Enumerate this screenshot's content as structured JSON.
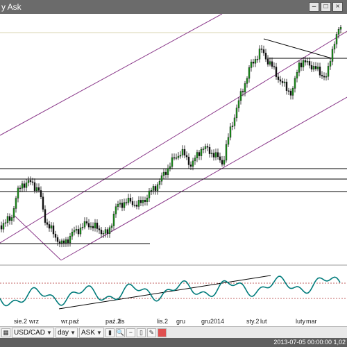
{
  "window": {
    "title": "y Ask"
  },
  "date_labels": [
    "sie.2",
    "wrz",
    "wr.paź",
    "paź.2",
    "lis",
    "lis.2",
    "gru",
    "gru2014",
    "sty.2",
    "lut",
    "luty",
    "mar"
  ],
  "toolbar": {
    "symbol": "USD/CAD",
    "period": "day",
    "price_type": "ASK"
  },
  "status": {
    "text": "2013-07-05 00:00:00  1,02"
  },
  "colors": {
    "up": "#1a9a1a",
    "down": "#111111",
    "channel": "#8b3a8b",
    "indicator": "#007b7b",
    "ref": "#b03030"
  }
}
